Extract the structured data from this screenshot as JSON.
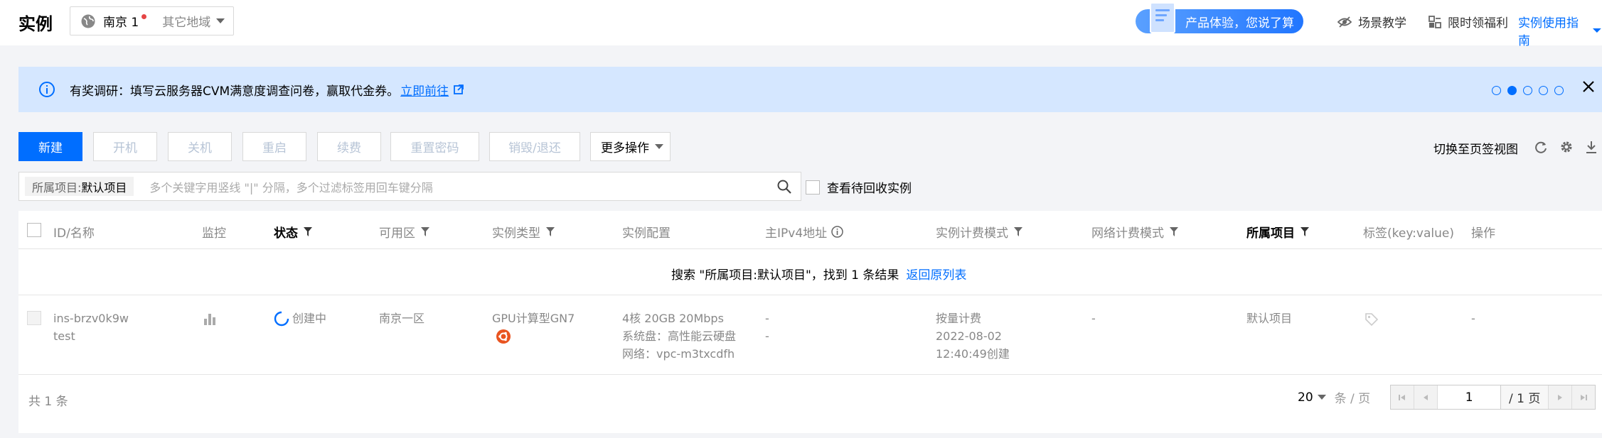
{
  "header": {
    "title": "实例",
    "region": {
      "current": "南京 1",
      "other": "其它地域"
    },
    "promo": "产品体验，您说了算",
    "links": {
      "scene": "场景教学",
      "welfare": "限时领福利",
      "guide": "实例使用指南"
    }
  },
  "banner": {
    "text": "有奖调研：填写云服务器CVM满意度调查问卷，赢取代金券。",
    "link": "立即前往"
  },
  "toolbar": {
    "create": "新建",
    "start": "开机",
    "stop": "关机",
    "restart": "重启",
    "renew": "续费",
    "reset_password": "重置密码",
    "destroy": "销毁/退还",
    "more": "更多操作",
    "switch_view": "切换至页签视图"
  },
  "search": {
    "tag_key": "所属项目:",
    "tag_value": "默认项目",
    "placeholder": "多个关键字用竖线 \"|\" 分隔，多个过滤标签用回车键分隔",
    "recycle_label": "查看待回收实例"
  },
  "table": {
    "columns": {
      "id": "ID/名称",
      "monitor": "监控",
      "status": "状态",
      "zone": "可用区",
      "type": "实例类型",
      "config": "实例配置",
      "ipv4": "主IPv4地址",
      "billing": "实例计费模式",
      "net_billing": "网络计费模式",
      "project": "所属项目",
      "tags": "标签(key:value)",
      "ops": "操作"
    },
    "result": {
      "message": "搜索 \"所属项目:默认项目\"，找到 1 条结果",
      "back": "返回原列表"
    },
    "rows": [
      {
        "id": "ins-brzv0k9w",
        "name": "test",
        "status": "创建中",
        "zone": "南京一区",
        "type": "GPU计算型GN7",
        "config1": "4核 20GB 20Mbps",
        "config2": "系统盘：高性能云硬盘",
        "config3": "网络：vpc-m3txcdfh",
        "ip1": "-",
        "ip2": "-",
        "billing": "按量计费",
        "date": "2022-08-02",
        "created": "12:40:49创建",
        "net_billing": "-",
        "project": "默认项目",
        "ops": "-"
      }
    ],
    "footer": {
      "total": "共 1 条",
      "page_size": "20",
      "unit": "条 / 页",
      "page": "1",
      "pages": "/ 1 页"
    }
  },
  "colors": {
    "accent": "#006eff",
    "banner_bg": "#d5e7ff"
  }
}
